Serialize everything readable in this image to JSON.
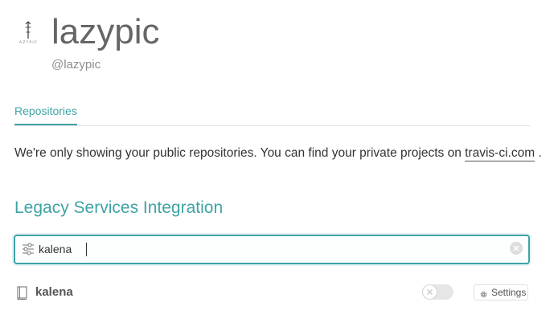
{
  "profile": {
    "name": "lazypic",
    "handle": "@lazypic",
    "logo_icon": "lazypic-logo"
  },
  "tabs": [
    {
      "label": "Repositories",
      "active": true
    }
  ],
  "notice": {
    "text": "We're only showing your public repositories. You can find your private projects on ",
    "link_text": "travis-ci.com",
    "suffix": "."
  },
  "section": {
    "title": "Legacy Services Integration"
  },
  "filter": {
    "value": "kalena",
    "icon": "filter-sliders-icon",
    "clear_icon": "clear-icon"
  },
  "repositories": [
    {
      "name": "kalena",
      "icon": "repo-book-icon",
      "enabled": false,
      "settings_label": "Settings"
    }
  ],
  "colors": {
    "accent": "#3fa3a5",
    "title": "#666666",
    "muted": "#8c8c8c"
  }
}
